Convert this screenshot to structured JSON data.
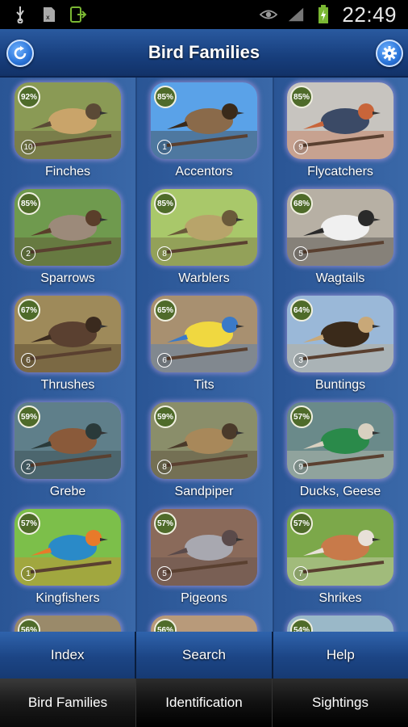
{
  "status_bar": {
    "time": "22:49",
    "icons": [
      "usb-icon",
      "sim-icon",
      "download-icon",
      "eye-icon",
      "signal-icon",
      "battery-charging-icon"
    ]
  },
  "header": {
    "title": "Bird Families",
    "left_button_icon": "refresh-icon",
    "right_button_icon": "gear-icon"
  },
  "families": [
    {
      "name": "Finches",
      "percent": "92%",
      "count": "10"
    },
    {
      "name": "Accentors",
      "percent": "85%",
      "count": "1"
    },
    {
      "name": "Flycatchers",
      "percent": "85%",
      "count": "9"
    },
    {
      "name": "Sparrows",
      "percent": "85%",
      "count": "2"
    },
    {
      "name": "Warblers",
      "percent": "85%",
      "count": "8"
    },
    {
      "name": "Wagtails",
      "percent": "68%",
      "count": "5"
    },
    {
      "name": "Thrushes",
      "percent": "67%",
      "count": "6"
    },
    {
      "name": "Tits",
      "percent": "65%",
      "count": "6"
    },
    {
      "name": "Buntings",
      "percent": "64%",
      "count": "3"
    },
    {
      "name": "Grebe",
      "percent": "59%",
      "count": "2"
    },
    {
      "name": "Sandpiper",
      "percent": "59%",
      "count": "8"
    },
    {
      "name": "Ducks, Geese",
      "percent": "57%",
      "count": "9"
    },
    {
      "name": "Kingfishers",
      "percent": "57%",
      "count": "1"
    },
    {
      "name": "Pigeons",
      "percent": "57%",
      "count": "5"
    },
    {
      "name": "Shrikes",
      "percent": "57%",
      "count": "7"
    },
    {
      "name": "",
      "percent": "56%",
      "count": ""
    },
    {
      "name": "",
      "percent": "56%",
      "count": ""
    },
    {
      "name": "",
      "percent": "54%",
      "count": ""
    }
  ],
  "menu": {
    "index": "Index",
    "search": "Search",
    "help": "Help"
  },
  "tabs": {
    "bird_families": "Bird Families",
    "identification": "Identification",
    "sightings": "Sightings"
  }
}
